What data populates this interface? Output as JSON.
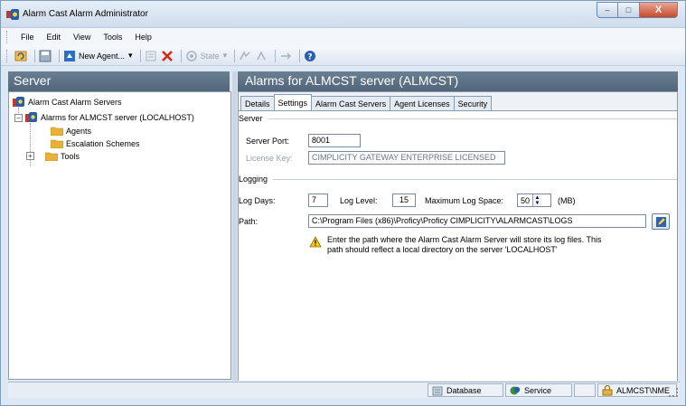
{
  "window": {
    "title": "Alarm Cast Alarm Administrator",
    "min_glyph": "–",
    "max_glyph": "□",
    "close_glyph": "X"
  },
  "menu": [
    "File",
    "Edit",
    "View",
    "Tools",
    "Help"
  ],
  "toolbar": {
    "new_agent_label": "New Agent...",
    "state_label": "State"
  },
  "left_panel": {
    "header": "Server",
    "tree": {
      "root": "Alarm Cast Alarm Servers",
      "server": "Alarms for ALMCST server (LOCALHOST)",
      "children": [
        "Agents",
        "Escalation Schemes",
        "Tools"
      ]
    }
  },
  "right_panel": {
    "header": "Alarms for ALMCST server (ALMCST)",
    "tabs": [
      "Details",
      "Settings",
      "Alarm Cast Servers",
      "Agent Licenses",
      "Security"
    ],
    "active_tab": "Settings",
    "server_group": {
      "title": "Server",
      "port_label": "Server Port:",
      "port_value": "8001",
      "license_label": "License Key:",
      "license_value": "CIMPLICITY GATEWAY ENTERPRISE LICENSED"
    },
    "logging_group": {
      "title": "Logging",
      "log_days_label": "Log Days:",
      "log_days_value": "7",
      "log_level_label": "Log Level:",
      "log_level_value": "15",
      "max_space_label": "Maximum Log Space:",
      "max_space_value": "50",
      "max_space_unit": "(MB)",
      "path_label": "Path:",
      "path_value": "C:\\Program Files (x86)\\Proficy\\Proficy CIMPLICITY\\ALARMCAST\\LOGS",
      "note_line1": "Enter the path where the Alarm Cast Alarm Server will store its log files. This",
      "note_line2": "path should reflect a local directory on the server 'LOCALHOST'"
    }
  },
  "statusbar": {
    "database": "Database",
    "service": "Service",
    "user": "ALMCST\\NME"
  },
  "colors": {
    "header_bg": "#5d7286",
    "window_bg": "#dce8f4",
    "folder": "#e8b23a"
  }
}
